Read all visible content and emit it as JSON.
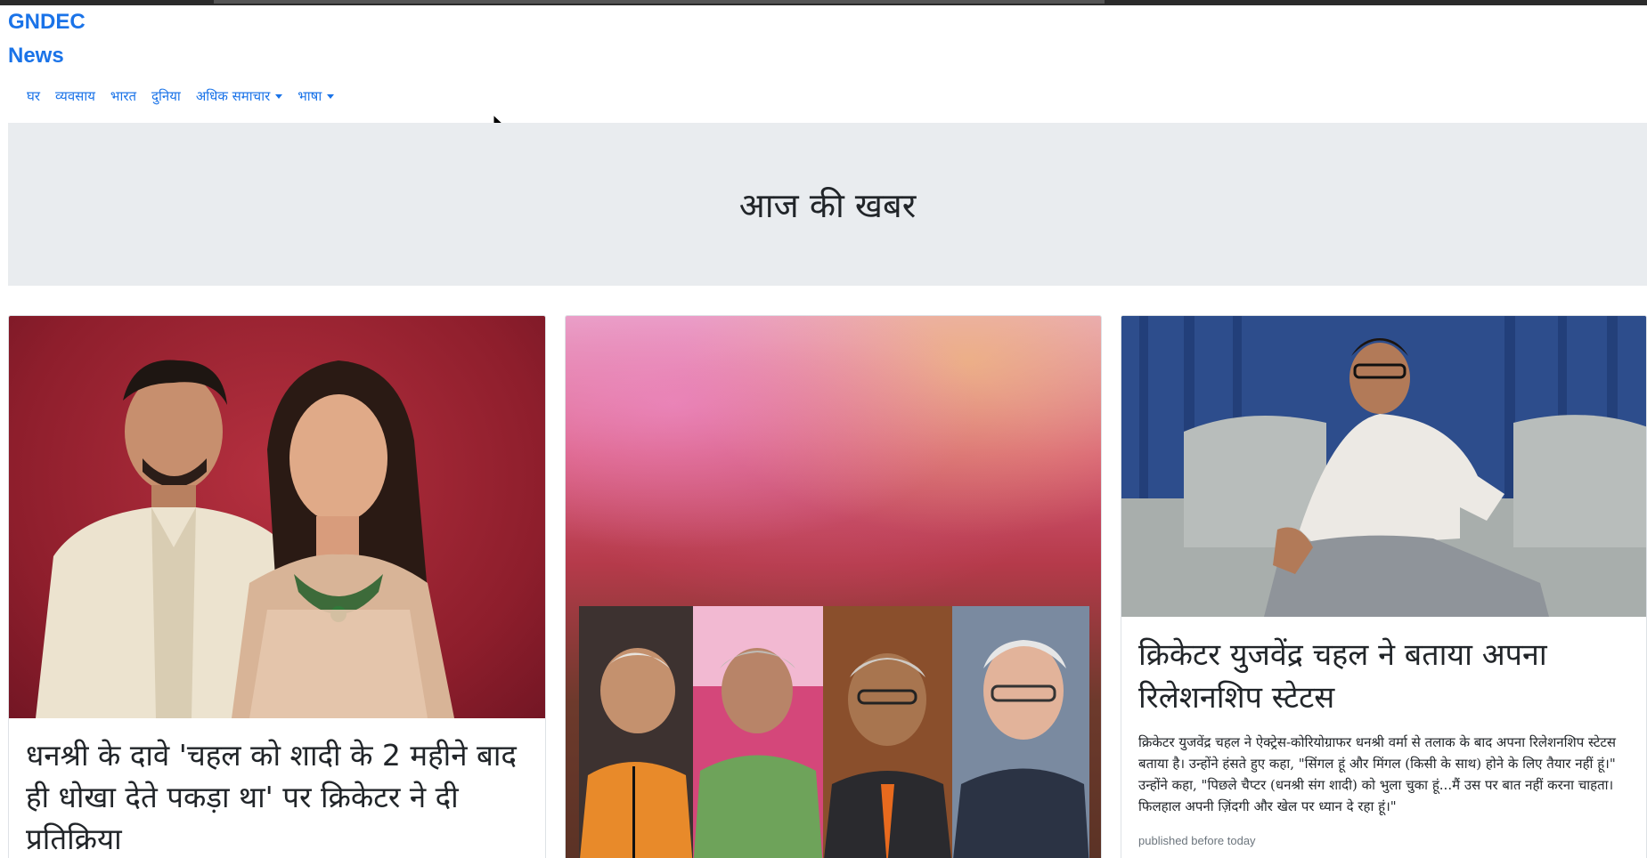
{
  "brand": {
    "line1": "GNDEC",
    "line2": "News"
  },
  "nav": {
    "items": [
      {
        "label": "घर"
      },
      {
        "label": "व्यवसाय"
      },
      {
        "label": "भारत"
      },
      {
        "label": "दुनिया"
      },
      {
        "label": "अधिक समाचार",
        "dropdown": true
      },
      {
        "label": "भाषा",
        "dropdown": true
      }
    ]
  },
  "hero": {
    "title": "आज की खबर"
  },
  "cards": [
    {
      "title": "धनश्री के दावे 'चहल को शादी के 2 महीने बाद ही धोखा देते पकड़ा था' पर क्रिकेटर ने दी प्रतिक्रिया"
    },
    {
      "title": ""
    },
    {
      "title": "क्रिकेटर युजवेंद्र चहल ने बताया अपना रिलेशनशिप स्टेटस",
      "text": "क्रिकेटर युजवेंद्र चहल ने ऐक्ट्रेस-कोरियोग्राफर धनश्री वर्मा से तलाक के बाद अपना रिलेशनशिप स्टेटस बताया है। उन्होंने हंसते हुए कहा, \"सिंगल हूं और मिंगल (किसी के साथ) होने के लिए तैयार नहीं हूं।\" उन्होंने कहा, \"पिछले चैप्टर (धनश्री संग शादी) को भुला चुका हूं...मैं उस पर बात नहीं करना चाहता। फिलहाल अपनी ज़िंदगी और खेल पर ध्यान दे रहा हूं।\"",
      "published": "published before today"
    }
  ],
  "colors": {
    "link": "#1a73e8",
    "hero_bg": "#e9ecef"
  }
}
